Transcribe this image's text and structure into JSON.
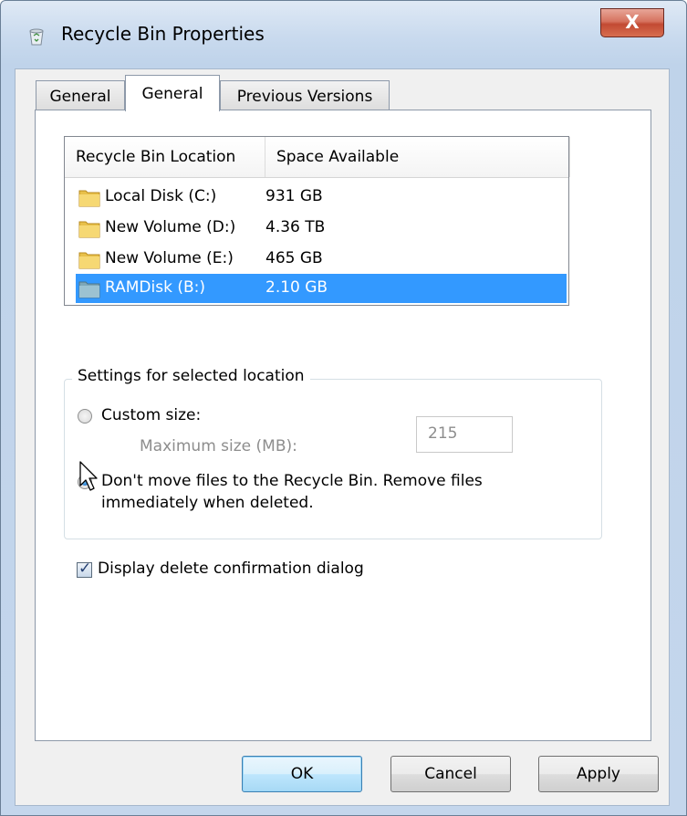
{
  "window": {
    "title": "Recycle Bin Properties",
    "close_label": "X"
  },
  "tabs": [
    {
      "label": "General",
      "active": false
    },
    {
      "label": "General",
      "active": true
    },
    {
      "label": "Previous Versions",
      "active": false
    }
  ],
  "locations": {
    "columns": [
      "Recycle Bin Location",
      "Space Available"
    ],
    "rows": [
      {
        "name": "Local Disk (C:)",
        "space": "931 GB",
        "icon": "folder-icon",
        "selected": false
      },
      {
        "name": "New Volume (D:)",
        "space": "4.36 TB",
        "icon": "folder-icon",
        "selected": false
      },
      {
        "name": "New Volume (E:)",
        "space": "465 GB",
        "icon": "folder-icon",
        "selected": false
      },
      {
        "name": "RAMDisk (B:)",
        "space": "2.10 GB",
        "icon": "ramdisk-icon",
        "selected": true
      }
    ]
  },
  "settings": {
    "group_label": "Settings for selected location",
    "custom_size_label": "Custom size:",
    "max_size_label": "Maximum size (MB):",
    "max_size_value": "215",
    "dont_move_line1": "Don't move files to the Recycle Bin. Remove files",
    "dont_move_line2": "immediately when deleted.",
    "selected_option": "dont_move"
  },
  "confirm": {
    "label": "Display delete confirmation dialog",
    "checked": true
  },
  "buttons": {
    "ok": "OK",
    "cancel": "Cancel",
    "apply": "Apply"
  },
  "colors": {
    "selection": "#3399ff",
    "close_button": "#c24a33"
  }
}
